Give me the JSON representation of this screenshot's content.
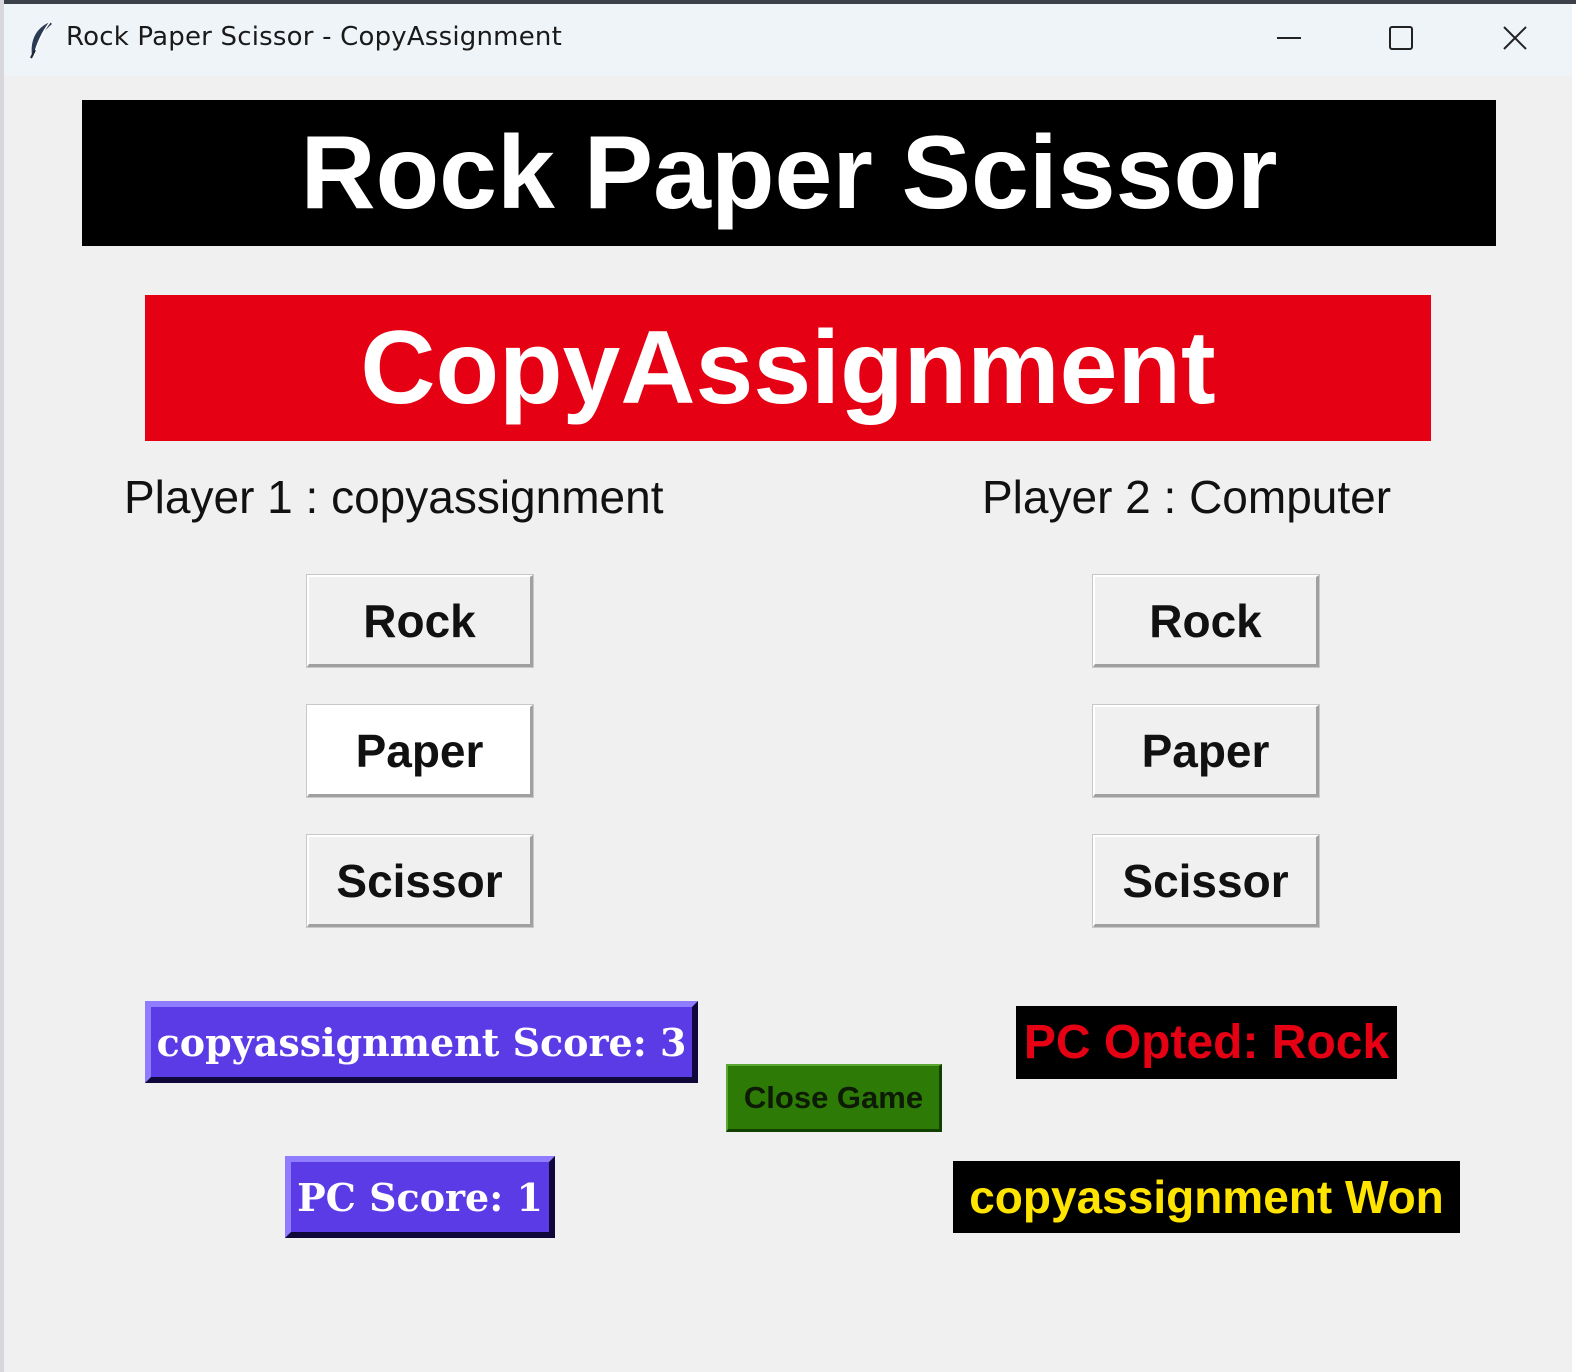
{
  "window": {
    "title": "Rock Paper Scissor - CopyAssignment",
    "app_icon": "feather-icon",
    "controls": [
      "minimize-icon",
      "maximize-icon",
      "close-icon"
    ]
  },
  "header": {
    "title": "Rock Paper Scissor",
    "brand": "CopyAssignment"
  },
  "player1": {
    "label": "Player 1 : copyassignment",
    "buttons": [
      "Rock",
      "Paper",
      "Scissor"
    ]
  },
  "player2": {
    "label": "Player 2 : Computer",
    "buttons": [
      "Rock",
      "Paper",
      "Scissor"
    ]
  },
  "scores": {
    "player_score": "copyassignment Score: 3",
    "pc_score": "PC Score: 1"
  },
  "controls": {
    "close_game": "Close Game"
  },
  "status": {
    "pc_opted": "PC Opted: Rock",
    "result": "copyassignment Won"
  },
  "colors": {
    "title_bg": "#000000",
    "brand_bg": "#e50014",
    "score_bg": "#5b3be6",
    "close_bg": "#2d7a06",
    "pc_opted_text": "#e50014",
    "result_text": "#ffe400"
  }
}
